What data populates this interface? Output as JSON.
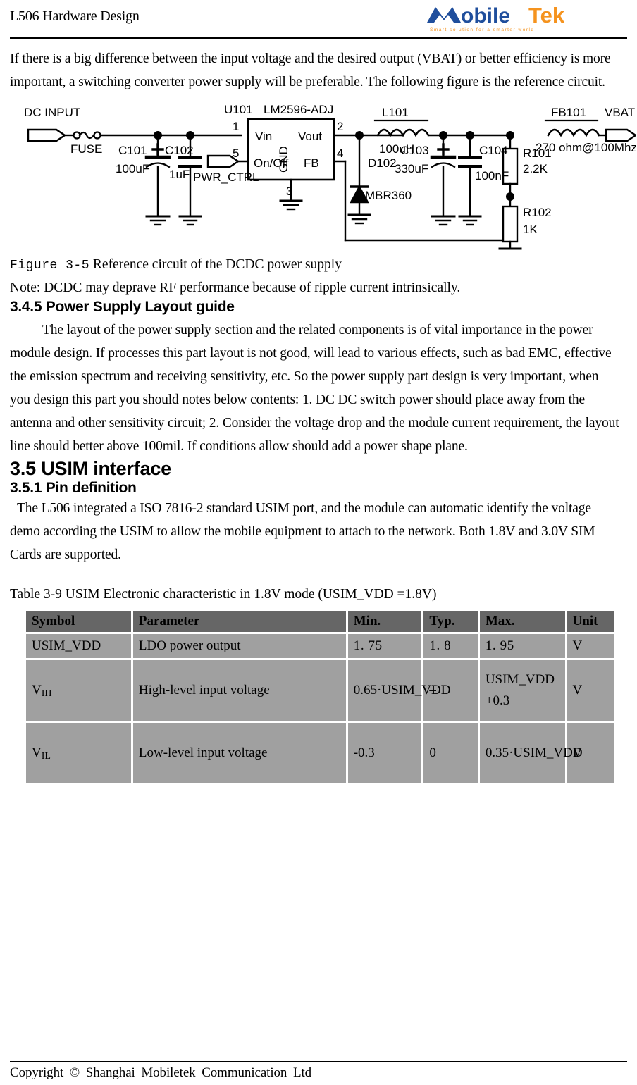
{
  "header": {
    "title": "L506 Hardware Design",
    "logo": {
      "name_part1": "obile",
      "name_part2": "Tek",
      "tagline": "Smart  solution  for  a  smarter  world",
      "color_blue": "#1F4E9C",
      "color_orange": "#F5931E"
    }
  },
  "intro": {
    "paragraph": "If there is a big difference between the input voltage and the desired output (VBAT) or better efficiency is more important, a switching converter power supply will be preferable. The following figure is the reference circuit."
  },
  "figure": {
    "number": "Figure 3-5",
    "caption": "Reference circuit of the DCDC power supply",
    "note": "Note: DCDC may deprave RF performance because of ripple current intrinsically.",
    "labels": {
      "dc_input": "DC INPUT",
      "fuse": "FUSE",
      "c101": "C101",
      "c101_val": "100uF",
      "c102": "C102",
      "c102_val": "1uF",
      "pwr_ctrl": "PWR_CTRL",
      "u101": "U101",
      "u101_part": "LM2596-ADJ",
      "pin1": "1",
      "pin2": "2",
      "pin3": "3",
      "pin4": "4",
      "pin5": "5",
      "vin": "Vin",
      "vout": "Vout",
      "onoff": "On/Off",
      "gnd": "GND",
      "fb": "FB",
      "d102": "D102",
      "d102_part": "MBR360",
      "l101": "L101",
      "l101_val": "100uH",
      "c103": "C103",
      "c103_val": "330uF",
      "c104": "C104",
      "c104_val": "100nF",
      "r101": "R101",
      "r101_val": "2.2K",
      "r102": "R102",
      "r102_val": "1K",
      "fb101": "FB101",
      "fb101_val": "270 ohm@100Mhz",
      "vbat": "VBAT"
    }
  },
  "section_345": {
    "heading": "3.4.5 Power Supply Layout guide",
    "body": "The layout of the power supply section and the related components is of vital importance in the power module design. If processes this part layout is not good, will lead to various effects, such as bad EMC, effective the emission spectrum and receiving sensitivity, etc. So the power supply part design is very important, when you design this part you should notes below contents: 1. DC DC switch power should place away from the antenna and other sensitivity circuit; 2. Consider the voltage drop and the module current requirement, the layout line should better above 100mil. If conditions allow should add a power shape plane."
  },
  "section_35": {
    "heading": "3.5 USIM interface"
  },
  "section_351": {
    "heading": "3.5.1 Pin definition",
    "body": "The L506 integrated a ISO 7816-2 standard USIM port, and the module can automatic identify the voltage demo according the USIM to allow the mobile equipment to attach to the network. Both 1.8V and 3.0V SIM Cards are supported."
  },
  "table": {
    "caption": "Table 3-9 USIM Electronic characteristic in 1.8V mode (USIM_VDD =1.8V)",
    "headers": [
      "Symbol",
      "Parameter",
      "Min.",
      "Typ.",
      "Max.",
      "Unit"
    ],
    "rows": [
      {
        "symbol": "USIM_VDD",
        "symbol_sub": "",
        "parameter": "LDO power output",
        "min": "1. 75",
        "typ": "1. 8",
        "max": "1. 95",
        "unit": "V"
      },
      {
        "symbol": "V",
        "symbol_sub": "IH",
        "parameter": "High-level input voltage",
        "min": "0.65·USIM_VDD",
        "typ": "–",
        "max": "USIM_VDD +0.3",
        "unit": "V"
      },
      {
        "symbol": "V",
        "symbol_sub": "IL",
        "parameter": "Low-level input voltage",
        "min": "-0.3",
        "typ": "0",
        "max": "0.35·USIM_VDD",
        "unit": "V"
      }
    ]
  },
  "footer": {
    "text": "Copyright © Shanghai  Mobiletek  Communication  Ltd"
  }
}
